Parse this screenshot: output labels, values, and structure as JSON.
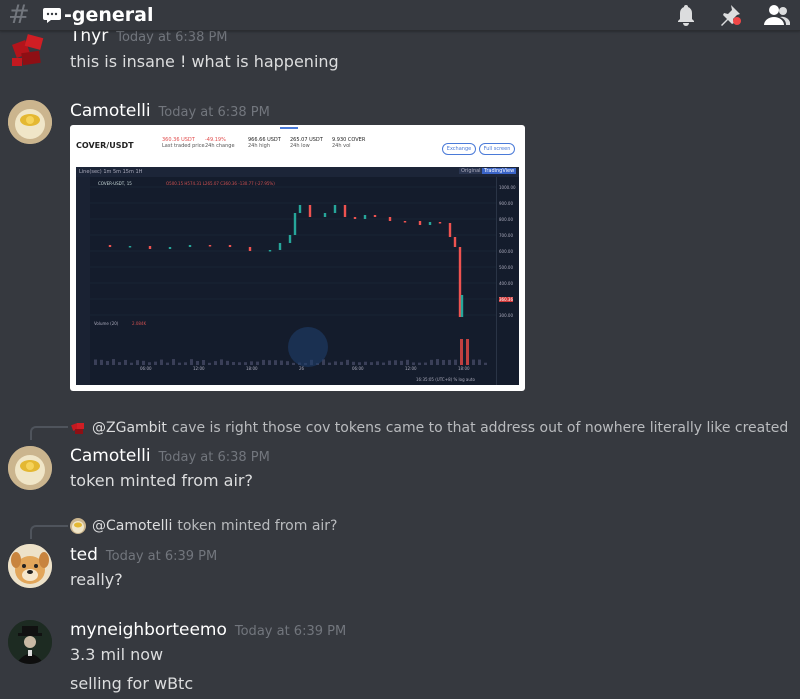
{
  "channel": {
    "hash": "#",
    "name": "-general"
  },
  "header_icons": [
    "bell-icon",
    "pin-icon",
    "members-icon"
  ],
  "messages": [
    {
      "user": "Thyr",
      "time": "Today at 6:38 PM",
      "lines": [
        "this is insane ! what is happening"
      ]
    },
    {
      "user": "Camotelli",
      "time": "Today at 6:38 PM",
      "lines": []
    },
    {
      "reply_to": "@ZGambit",
      "reply_text": "cave is right those cov tokens came to that address out of nowhere literally like created",
      "user": "Camotelli",
      "time": "Today at 6:38 PM",
      "lines": [
        "token minted from air?"
      ]
    },
    {
      "reply_to": "@Camotelli",
      "reply_text": "token minted from air?",
      "user": "ted",
      "time": "Today at 6:39 PM",
      "lines": [
        "really?"
      ]
    },
    {
      "user": "myneighborteemo",
      "time": "Today at 6:39 PM",
      "lines": [
        "3.3 mil now",
        "selling for wBtc"
      ]
    }
  ],
  "embed": {
    "pair": "COVER/USDT",
    "stats": [
      {
        "value": "360.36 USDT",
        "label": "Last traded price"
      },
      {
        "value": "-49.19%",
        "label": "24h change"
      },
      {
        "value": "966.66 USDT",
        "label": "24h high"
      },
      {
        "value": "265.07 USDT",
        "label": "24h low"
      },
      {
        "value": "9.930 COVER",
        "label": "24h vol"
      }
    ],
    "buttons": [
      "Exchange",
      "Full screen"
    ],
    "toolbar": "Line(sec)  1m  5m  15m  1H",
    "chart_title": "COVER-USDT, 15",
    "ohlc": "O500.15  H574.31  L265.07  C360.36  -130.77 (-27.95%)",
    "volume_label": "Volume (20)",
    "volume_value": "2.084K",
    "views": [
      "Original",
      "TradingView"
    ],
    "price_axis": [
      "1000.00",
      "900.00",
      "800.00",
      "700.00",
      "600.00",
      "500.00",
      "400.00",
      "360.36",
      "300.00"
    ],
    "time_axis": [
      "06:00",
      "12:00",
      "18:00",
      "26",
      "06:00",
      "12:00",
      "18:00"
    ],
    "footer": "16:35:05 (UTC+8)   %   log   auto"
  }
}
